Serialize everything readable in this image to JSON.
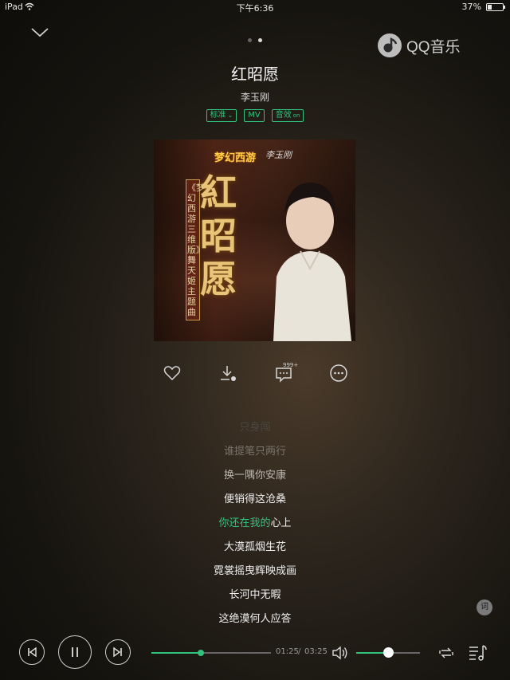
{
  "status_bar": {
    "device": "iPad",
    "time": "下午6:36",
    "battery_percent_text": "37%",
    "battery_level": 0.37
  },
  "pager": {
    "pages": 2,
    "active": 1
  },
  "brand": {
    "name": "QQ音乐"
  },
  "song": {
    "title": "红昭愿",
    "artist": "李玉刚",
    "badges": [
      "标准",
      "MV",
      "音效"
    ],
    "badge_icons": [
      "chevron-down-icon",
      null,
      "on-icon"
    ]
  },
  "album": {
    "game_logo": "梦幻西游",
    "signature": "李玉刚",
    "calligraphy": "紅昭愿",
    "vertical_label": "《梦幻西游三维版》舞天姬主题曲"
  },
  "actions": {
    "comment_count": "999+"
  },
  "lyrics": {
    "lines": [
      "只身闯",
      "谁提笔只两行",
      "换一隅你安康",
      "便销得这沧桑",
      "你还在我的心上",
      "大漠孤烟生花",
      "霓裳摇曳辉映成画",
      "长河中无暇",
      "这绝漠何人应答"
    ],
    "current_index": 4,
    "current_played": "你还在我的",
    "current_rest": "心上",
    "lyric_toggle_label": "词"
  },
  "playback": {
    "elapsed": "01:25",
    "total": "03:25",
    "progress": 0.415,
    "volume": 0.5
  },
  "colors": {
    "accent": "#31c27c",
    "text": "#ffffff",
    "muted": "#9a9a9a"
  }
}
